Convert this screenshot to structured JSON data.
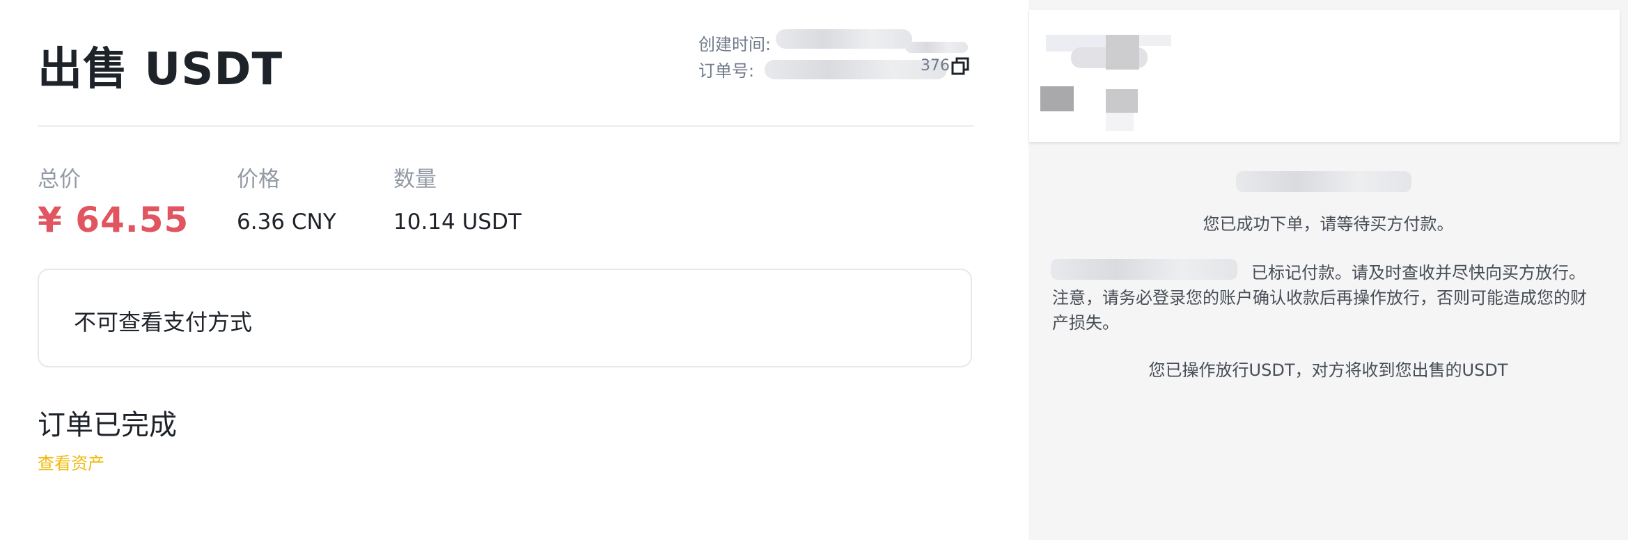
{
  "page": {
    "title": "出售 USDT",
    "created_label": "创建时间:",
    "order_no_label": "订单号:",
    "order_no_tail": "376",
    "total_label": "总价",
    "total_value": "¥ 64.55",
    "price_label": "价格",
    "price_value": "6.36 CNY",
    "qty_label": "数量",
    "qty_value": "10.14 USDT",
    "payment_text": "不可查看支付方式",
    "status_text": "订单已完成",
    "view_assets_link": "查看资产"
  },
  "chat": {
    "msg_order_placed": "您已成功下单，请等待买方付款。",
    "msg_marked_paid_line1_tail": "已标记付款。请及时查收并尽快向买方放行。",
    "msg_marked_paid_line2": "注意，请务必登录您的账户确认收款后再操作放行，否则可能造成您的财",
    "msg_marked_paid_line3": "产损失。",
    "msg_released": "您已操作放行USDT，对方将收到您出售的USDT"
  },
  "colors": {
    "price_red": "#e0555f",
    "link_yellow": "#f0b90b",
    "text_dark": "#1e2329",
    "text_gray": "#707a8a",
    "panel_bg": "#f5f5f5"
  },
  "icons": {
    "copy": "copy-icon"
  }
}
